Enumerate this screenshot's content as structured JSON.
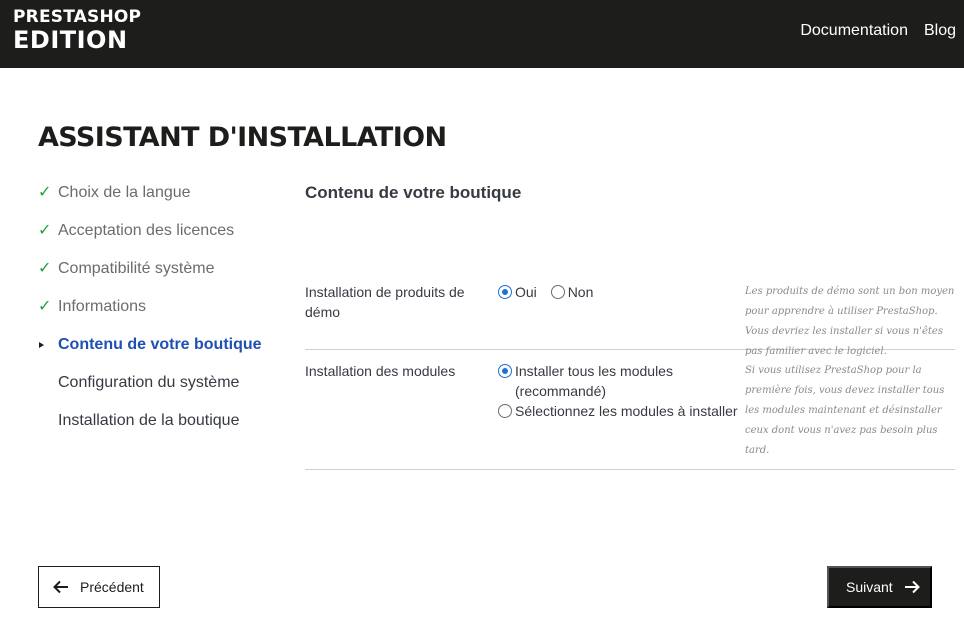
{
  "header": {
    "logo_line1": "PRESTASHOP",
    "logo_line2": "EDITION",
    "links": [
      "Documentation",
      "Blog"
    ]
  },
  "page_title": "ASSISTANT D'INSTALLATION",
  "steps": [
    {
      "label": "Choix de la langue",
      "state": "done"
    },
    {
      "label": "Acceptation des licences",
      "state": "done"
    },
    {
      "label": "Compatibilité système",
      "state": "done"
    },
    {
      "label": "Informations",
      "state": "done"
    },
    {
      "label": "Contenu de votre boutique",
      "state": "current"
    },
    {
      "label": "Configuration du système",
      "state": "todo"
    },
    {
      "label": "Installation de la boutique",
      "state": "todo"
    }
  ],
  "content": {
    "title": "Contenu de votre boutique",
    "demo": {
      "label": "Installation de produits de démo",
      "options": [
        {
          "label": "Oui",
          "checked": true
        },
        {
          "label": "Non",
          "checked": false
        }
      ],
      "help": "Les produits de démo sont un bon moyen pour apprendre à utiliser PrestaShop. Vous devriez les installer si vous n'êtes pas familier avec le logiciel."
    },
    "modules": {
      "label": "Installation des modules",
      "options": [
        {
          "label": "Installer tous les modules (recommandé)",
          "checked": true
        },
        {
          "label": "Sélectionnez les modules à installer",
          "checked": false
        }
      ],
      "help": "Si vous utilisez PrestaShop pour la première fois, vous devez installer tous les modules maintenant et désinstaller ceux dont vous n'avez pas besoin plus tard."
    }
  },
  "buttons": {
    "previous": "Précédent",
    "next": "Suivant"
  },
  "colors": {
    "header_bg": "#1d1d1b",
    "check_green": "#25a03b",
    "current_blue": "#1e50b4",
    "radio_blue": "#1e6fd9"
  }
}
